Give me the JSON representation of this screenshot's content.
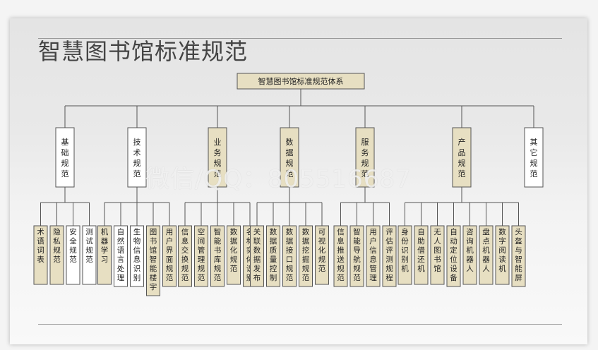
{
  "title": "智慧图书馆标准规范",
  "root": "智慧图书馆标准规范体系",
  "watermark": "微信/QQ：805516687",
  "colors": {
    "tan": "#e7dfc2",
    "white": "#ffffff",
    "border": "#555555",
    "line": "#555555"
  },
  "categories": [
    {
      "name": "基础规范",
      "fill": "white",
      "children": [
        {
          "name": "术语词表",
          "fill": "tan"
        },
        {
          "name": "隐私规范",
          "fill": "tan"
        },
        {
          "name": "安全规范",
          "fill": "white"
        },
        {
          "name": "测试规范",
          "fill": "white"
        }
      ]
    },
    {
      "name": "技术规范",
      "fill": "white",
      "children": [
        {
          "name": "机器学习",
          "fill": "tan"
        },
        {
          "name": "自然语言处理",
          "fill": "white"
        },
        {
          "name": "生物信息识别",
          "fill": "white"
        },
        {
          "name": "图书馆智能楼宇",
          "fill": "tan"
        },
        {
          "name": "用户界面规范",
          "fill": "tan"
        }
      ]
    },
    {
      "name": "业务规范",
      "fill": "tan",
      "children": [
        {
          "name": "信息交换规范",
          "fill": "tan"
        },
        {
          "name": "空间管理规范",
          "fill": "tan"
        },
        {
          "name": "智能书库规范",
          "fill": "tan"
        },
        {
          "name": "数据化规范",
          "fill": "tan"
        },
        {
          "name": "名称实体识别",
          "fill": "tan"
        }
      ]
    },
    {
      "name": "数据规范",
      "fill": "tan",
      "children": [
        {
          "name": "关联数据发布",
          "fill": "tan"
        },
        {
          "name": "数据质量控制",
          "fill": "tan"
        },
        {
          "name": "数据接口规范",
          "fill": "tan"
        },
        {
          "name": "数据挖掘规范",
          "fill": "tan"
        },
        {
          "name": "可视化规范",
          "fill": "tan"
        }
      ]
    },
    {
      "name": "服务规范",
      "fill": "tan",
      "children": [
        {
          "name": "信息推送规范",
          "fill": "tan"
        },
        {
          "name": "智能导航规范",
          "fill": "tan"
        },
        {
          "name": "用户信息管理",
          "fill": "tan"
        },
        {
          "name": "评估评测规程",
          "fill": "tan"
        }
      ]
    },
    {
      "name": "产品规范",
      "fill": "tan",
      "children": [
        {
          "name": "身份识别机",
          "fill": "tan"
        },
        {
          "name": "自助借还机",
          "fill": "tan"
        },
        {
          "name": "无人图书馆",
          "fill": "tan"
        },
        {
          "name": "自动定位设备",
          "fill": "tan"
        },
        {
          "name": "咨询机器人",
          "fill": "tan"
        },
        {
          "name": "盘点机器人",
          "fill": "tan"
        },
        {
          "name": "数字阅读机",
          "fill": "tan"
        },
        {
          "name": "头盔与智能屏",
          "fill": "tan"
        }
      ]
    },
    {
      "name": "其它规范",
      "fill": "white",
      "children": []
    }
  ]
}
